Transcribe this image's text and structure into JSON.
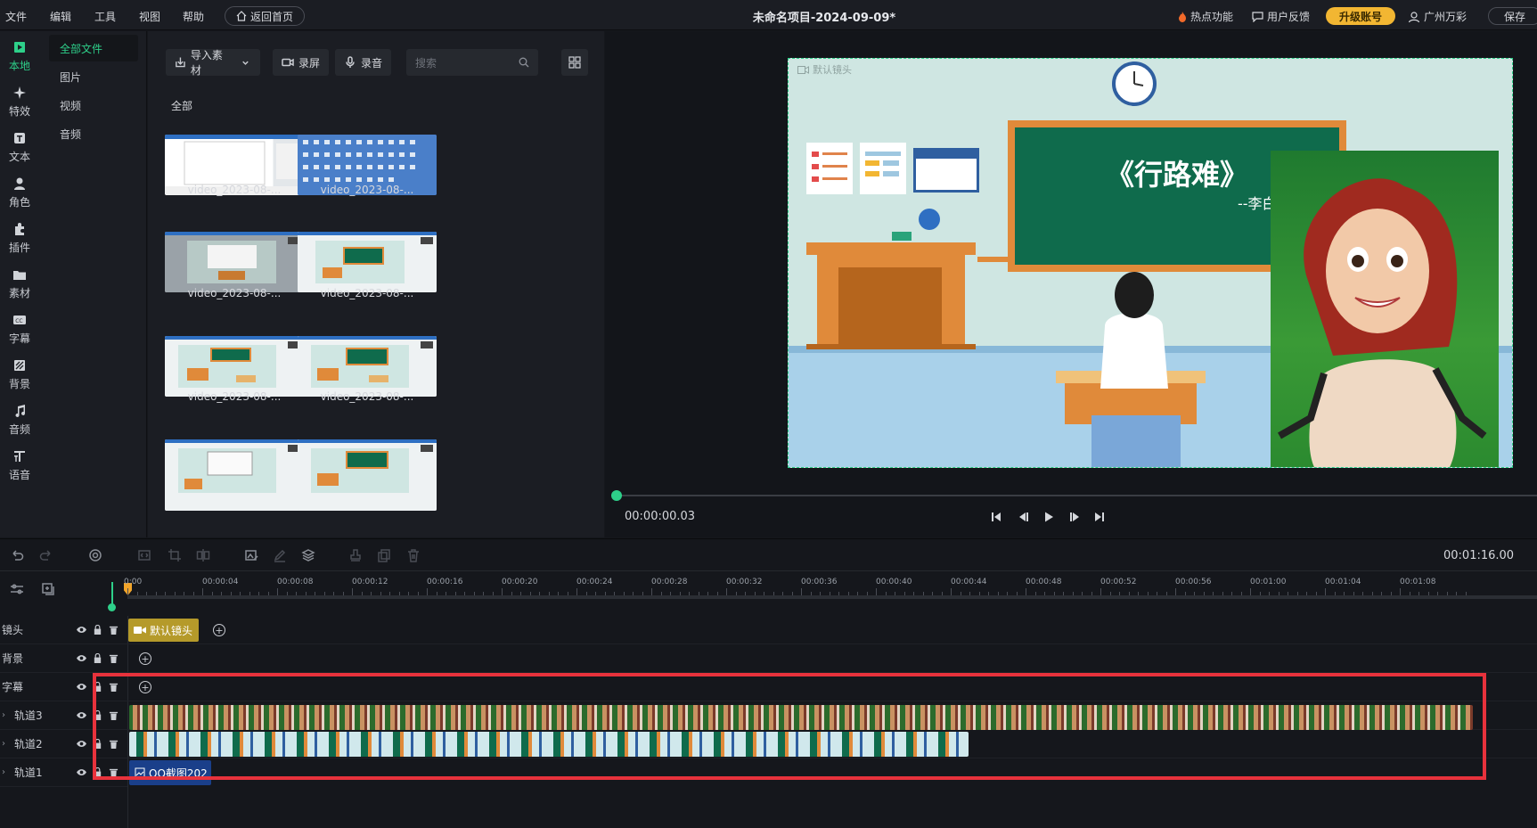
{
  "menu": {
    "file": "文件",
    "edit": "编辑",
    "tools": "工具",
    "view": "视图",
    "help": "帮助",
    "home": "返回首页"
  },
  "title": "未命名项目-2024-09-09*",
  "topright": {
    "hot": "热点功能",
    "feedback": "用户反馈",
    "upgrade": "升级账号",
    "user": "广州万彩",
    "save": "保存"
  },
  "leftbar": {
    "items": [
      {
        "label": "本地",
        "icon": "local-icon"
      },
      {
        "label": "特效",
        "icon": "effects-icon"
      },
      {
        "label": "文本",
        "icon": "text-icon"
      },
      {
        "label": "角色",
        "icon": "character-icon"
      },
      {
        "label": "插件",
        "icon": "plugin-icon"
      },
      {
        "label": "素材",
        "icon": "material-icon"
      },
      {
        "label": "字幕",
        "icon": "subtitle-icon"
      },
      {
        "label": "背景",
        "icon": "background-icon"
      },
      {
        "label": "音频",
        "icon": "audio-icon"
      },
      {
        "label": "语音",
        "icon": "voice-icon"
      }
    ]
  },
  "subnav": {
    "all": "全部文件",
    "image": "图片",
    "video": "视频",
    "audio": "音频"
  },
  "media": {
    "import": "导入素材",
    "record_screen": "录屏",
    "record_audio": "录音",
    "search_placeholder": "搜索",
    "all_label": "全部",
    "items": [
      "video_2023-08-...",
      "video_2023-08-...",
      "video_2023-08-...",
      "video_2023-08-...",
      "video_2023-08-...",
      "video_2023-08-..."
    ]
  },
  "preview": {
    "stage_tag": "默认镜头",
    "board_title": "《行路难》",
    "board_sub": "--李白",
    "time": "00:00:00.03"
  },
  "timeline": {
    "total": "00:01:16.00",
    "ticks": [
      "0:00",
      "00:00:04",
      "00:00:08",
      "00:00:12",
      "00:00:16",
      "00:00:20",
      "00:00:24",
      "00:00:28",
      "00:00:32",
      "00:00:36",
      "00:00:40",
      "00:00:44",
      "00:00:48",
      "00:00:52",
      "00:00:56",
      "00:01:00",
      "00:01:04",
      "00:01:08"
    ],
    "tracks": {
      "lens": "镜头",
      "bg": "背景",
      "subtitle": "字幕",
      "track3": "轨道3",
      "track2": "轨道2",
      "track1": "轨道1"
    },
    "lens_clip": "默认镜头",
    "clip1": "QQ截图202"
  },
  "colors": {
    "accent": "#2ed08a",
    "upgrade": "#f2b632",
    "highlight": "#e8323c"
  }
}
